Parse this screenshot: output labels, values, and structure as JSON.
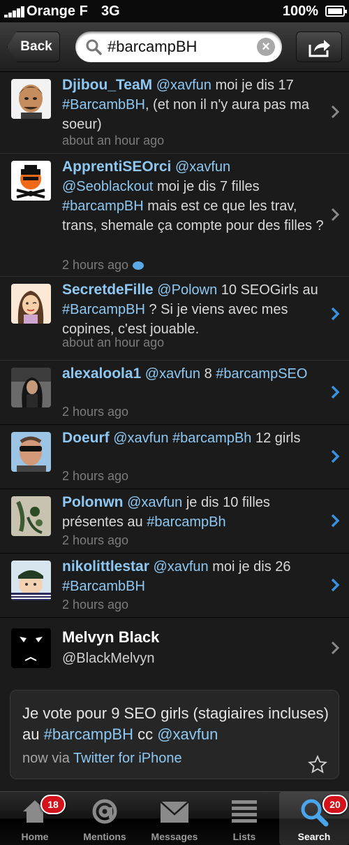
{
  "status_bar": {
    "carrier": "Orange F",
    "network": "3G",
    "battery": "100%"
  },
  "nav": {
    "back_label": "Back",
    "search_value": "#barcampBH"
  },
  "tweets": [
    {
      "user": "Djibou_TeaM",
      "parts": [
        " ",
        "@xavfun",
        " moi je dis 17 ",
        "#BarcambBH",
        ", (et non il n'y aura pas ma soeur)"
      ],
      "time": "about an hour ago"
    },
    {
      "user": "ApprentiSEOrci",
      "parts": [
        " ",
        "@xavfun",
        " ",
        "@Seoblackout",
        " moi je dis 7 filles ",
        "#barcampBH",
        " mais est ce que les trav, trans, shemale ça compte pour des filles ?"
      ],
      "time": "2 hours ago"
    },
    {
      "user": "SecretdeFille",
      "parts": [
        " ",
        "@Polown",
        " 10 SEOGirls au ",
        "#BarcampBH",
        " ? Si je viens avec mes copines, c'est jouable."
      ],
      "time": "about an hour ago"
    },
    {
      "user": "alexaloola1",
      "parts": [
        " ",
        "@xavfun",
        " 8 ",
        "#barcampSEO",
        ""
      ],
      "time": "2 hours ago"
    },
    {
      "user": "Doeurf",
      "parts": [
        " ",
        "@xavfun",
        " ",
        "#barcampBh",
        " 12 girls"
      ],
      "time": "2 hours ago"
    },
    {
      "user": "Polonwn",
      "parts": [
        " ",
        "@xavfun",
        " je dis 10 filles présentes au ",
        "#barcampBh",
        ""
      ],
      "time": "2 hours ago"
    },
    {
      "user": "nikolittlestar",
      "parts": [
        " ",
        "@xavfun",
        " moi je dis 26 ",
        "#BarcambBH",
        ""
      ],
      "time": "2 hours ago"
    }
  ],
  "profile": {
    "name": "Melvyn Black",
    "handle": "@BlackMelvyn"
  },
  "card": {
    "text_1": "Je vote pour 9 SEO girls (stagiaires incluses) au ",
    "hashtag": "#barcampBH",
    "text_2": " cc ",
    "mention": "@xavfun",
    "time": "now via ",
    "app": "Twitter for iPhone"
  },
  "tabs": [
    {
      "label": "Home",
      "badge": "18"
    },
    {
      "label": "Mentions",
      "badge": ""
    },
    {
      "label": "Messages",
      "badge": ""
    },
    {
      "label": "Lists",
      "badge": ""
    },
    {
      "label": "Search",
      "badge": "20"
    }
  ],
  "colors": {
    "link": "#8ec8f2",
    "badge": "#d4121b",
    "chevron_blue": "#3b8fe0",
    "chevron_gray": "#8a8a8a"
  },
  "icons": [
    "search-icon",
    "clear-icon",
    "share-icon",
    "chevron-right-icon",
    "reply-bubble-icon",
    "star-icon",
    "home-icon",
    "at-icon",
    "envelope-icon",
    "list-icon",
    "magnifier-icon"
  ]
}
